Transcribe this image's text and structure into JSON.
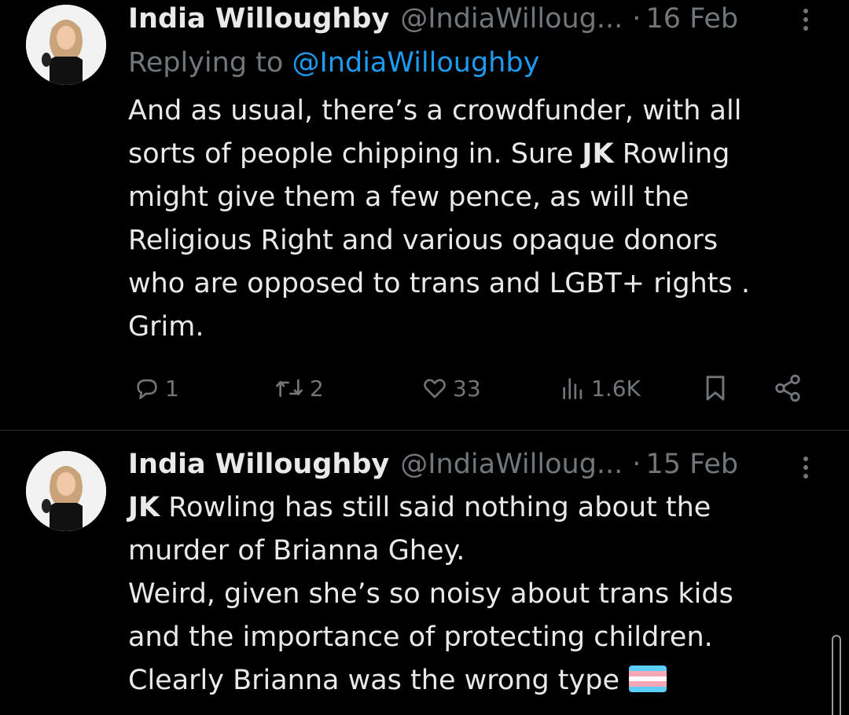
{
  "tweets": [
    {
      "name": "India Willoughby",
      "handle": "@IndiaWilloug...",
      "dot": "·",
      "date": "16 Feb",
      "replying_prefix": "Replying to",
      "replying_to": "@IndiaWilloughby",
      "lines": [
        "And as usual, there’s a crowdfunder, with all",
        "sorts of people chipping in. Sure ",
        "might give them a few pence, as will the",
        "Religious Right and various opaque donors",
        "who are opposed to trans and LGBT+ rights .",
        "Grim."
      ],
      "bold_jk": "JK",
      "line2_tail": " Rowling",
      "stats": {
        "replies": "1",
        "reposts": "2",
        "likes": "33",
        "views": "1.6K"
      }
    },
    {
      "name": "India Willoughby",
      "handle": "@IndiaWilloug...",
      "dot": "·",
      "date": "15 Feb",
      "bold_jk": "JK",
      "lines": [
        " Rowling has still said nothing about the",
        "murder of Brianna Ghey.",
        "Weird, given she’s so noisy about trans kids",
        "and the importance of protecting children.",
        "Clearly Brianna was the wrong type"
      ]
    }
  ],
  "colors": {
    "background": "#000000",
    "text": "#e7e9ea",
    "muted": "#71767b",
    "link": "#1d9bf0",
    "divider": "#2f3336"
  },
  "icons": {
    "reply": "reply-icon",
    "repost": "repost-icon",
    "like": "heart-icon",
    "views": "views-icon",
    "bookmark": "bookmark-icon",
    "share": "share-icon",
    "more": "more-vertical-icon",
    "flag": "trans-flag-emoji"
  }
}
